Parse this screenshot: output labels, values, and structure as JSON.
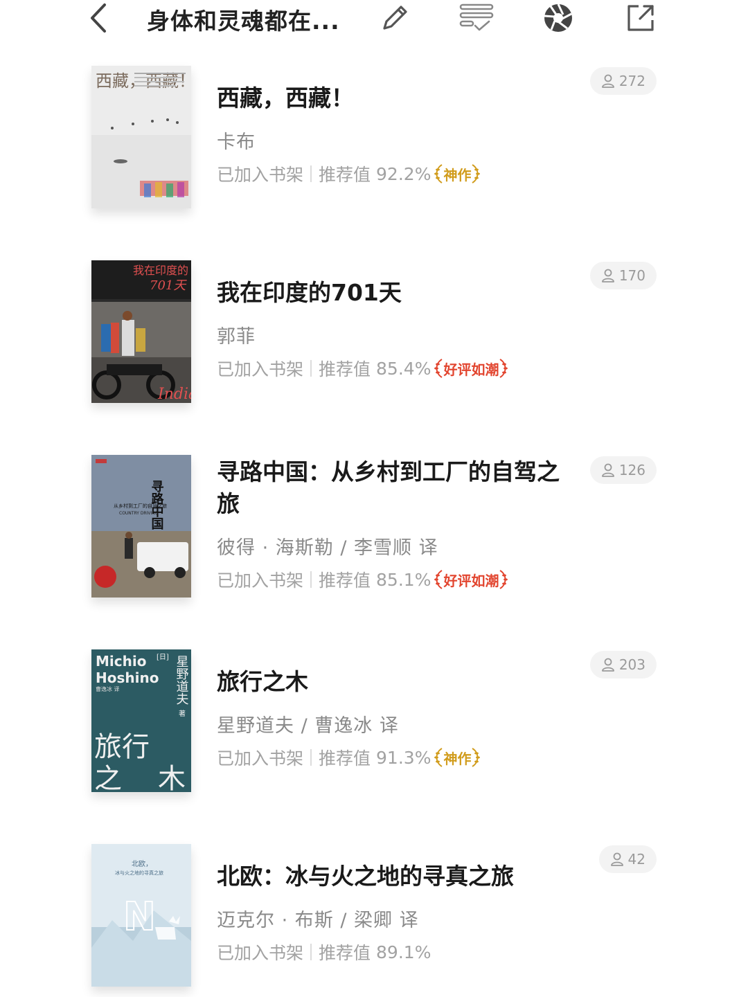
{
  "header": {
    "title": "身体和灵魂都在..."
  },
  "books": [
    {
      "title": "西藏，西藏！",
      "author": "卡布",
      "shelf_status": "已加入书架",
      "recommend_label": "推荐值",
      "recommend_value": "92.2%",
      "badge": "神作",
      "badge_color": "#d19c1c",
      "readers": "272"
    },
    {
      "title": "我在印度的701天",
      "author": "郭菲",
      "shelf_status": "已加入书架",
      "recommend_label": "推荐值",
      "recommend_value": "85.4%",
      "badge": "好评如潮",
      "badge_color": "#e2452f",
      "readers": "170"
    },
    {
      "title": "寻路中国：从乡村到工厂的自驾之旅",
      "author": "彼得 · 海斯勒 / 李雪顺 译",
      "shelf_status": "已加入书架",
      "recommend_label": "推荐值",
      "recommend_value": "85.1%",
      "badge": "好评如潮",
      "badge_color": "#e2452f",
      "readers": "126"
    },
    {
      "title": "旅行之木",
      "author": "星野道夫 / 曹逸冰 译",
      "shelf_status": "已加入书架",
      "recommend_label": "推荐值",
      "recommend_value": "91.3%",
      "badge": "神作",
      "badge_color": "#d19c1c",
      "readers": "203"
    },
    {
      "title": "北欧：冰与火之地的寻真之旅",
      "author": "迈克尔 · 布斯 / 梁卿 译",
      "shelf_status": "已加入书架",
      "recommend_label": "推荐值",
      "recommend_value": "89.1%",
      "readers": "42"
    }
  ],
  "covers": {
    "tibet": {
      "title": "西藏，西藏！"
    },
    "india": {
      "title": "我在印度的",
      "number": "701天",
      "word": "India"
    },
    "china": {
      "title": "寻路中国",
      "subtitle": "从乡村到工厂的自驾之旅",
      "english": "COUNTRY DRIVING"
    },
    "wood": {
      "en1": "Michio",
      "en2": "Hoshino",
      "country": "[日]",
      "author": "星野道夫",
      "suffix": "著",
      "translator": "曹逸冰 译",
      "title1": "旅行",
      "title2": "之",
      "title3": "木"
    },
    "nordic": {
      "line1": "北欧，",
      "line2": "冰与火之地的寻真之旅",
      "letter": "N"
    }
  }
}
